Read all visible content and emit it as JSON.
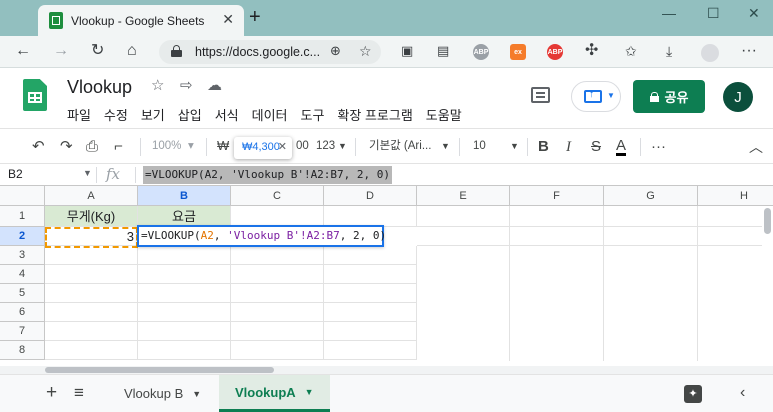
{
  "browser": {
    "tab_title": "Vlookup - Google Sheets",
    "tab_close": "✕",
    "new_tab": "+",
    "url": "https://docs.google.c...",
    "window_controls": [
      "—",
      "☐",
      "✕"
    ],
    "extensions": [
      "ABP",
      "ex",
      "ABP"
    ],
    "more": "···"
  },
  "sheets": {
    "doc_title": "Vlookup",
    "menu": [
      "파일",
      "수정",
      "보기",
      "삽입",
      "서식",
      "데이터",
      "도구",
      "확장 프로그램",
      "도움말"
    ],
    "share_label": "공유",
    "avatar_initial": "J",
    "accent_color": "#0d7e52"
  },
  "toolbar": {
    "zoom": "100%",
    "currency": "₩",
    "more_formats": "123",
    "font": "기본값 (Ari...",
    "font_size": "10",
    "bold": "B",
    "italic": "I",
    "strike": "S",
    "text_color": "A",
    "more": "···"
  },
  "tooltip": {
    "text": "₩4,300",
    "close": "✕"
  },
  "formula_bar": {
    "cell_ref": "B2",
    "fx": "fx",
    "formula": "=VLOOKUP(A2, 'Vlookup B'!A2:B7, 2, 0)"
  },
  "grid": {
    "columns": [
      "A",
      "B",
      "C",
      "D",
      "E",
      "F",
      "G",
      "H"
    ],
    "rows": [
      "1",
      "2",
      "3",
      "4",
      "5",
      "6",
      "7",
      "8"
    ],
    "cells": {
      "A1": "무게(Kg)",
      "B1": "요금",
      "A2": "3"
    },
    "editor": {
      "p1": "=VLOOKUP(",
      "ref1": "A2",
      "p2": ", ",
      "str": "'Vlookup B'",
      "ref2": "!A2:B7",
      "p3": ", ",
      "n1": "2",
      "p4": ", ",
      "n2": "0",
      "p5": ")"
    }
  },
  "sheet_tabs": [
    {
      "label": "Vlookup B",
      "active": false
    },
    {
      "label": "VlookupA",
      "active": true
    }
  ]
}
